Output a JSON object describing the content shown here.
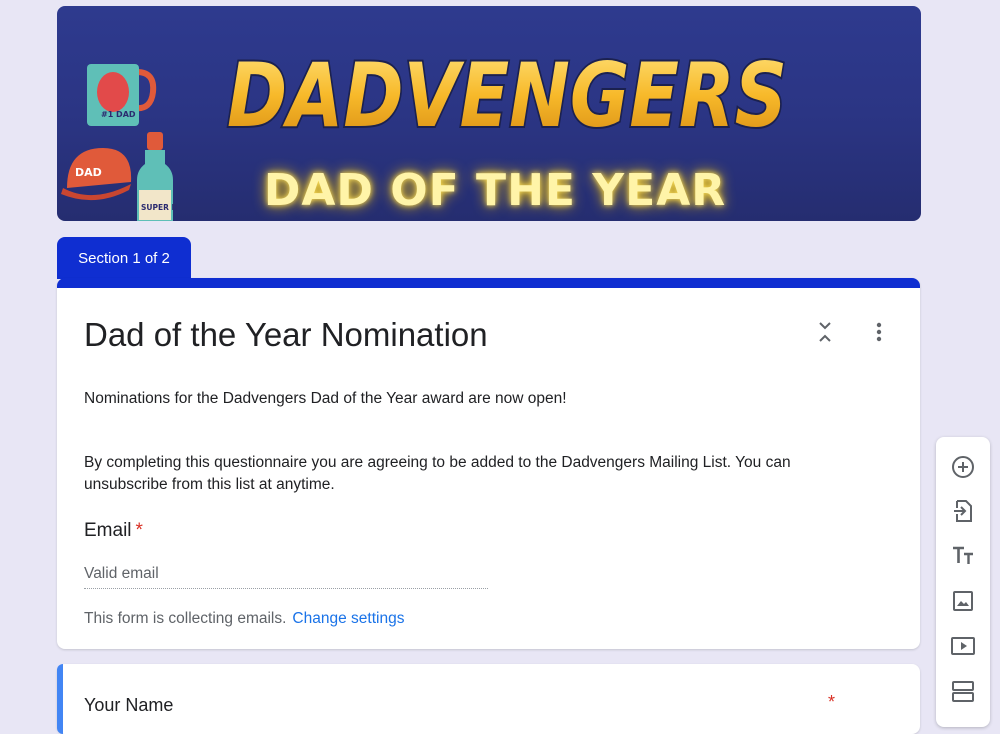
{
  "banner": {
    "logo_text": "DADVENGERS",
    "subtitle": "DAD OF THE YEAR",
    "mug_text": "#1 DAD",
    "cap_text": "DAD",
    "bottle_text": "SUPER DAD"
  },
  "section_tab": "Section 1 of 2",
  "form": {
    "title": "Dad of the Year Nomination",
    "description_1": "Nominations for the Dadvengers Dad of the Year award are now open!",
    "description_2": "By completing this questionnaire you are agreeing to be added to the Dadvengers Mailing List. You can unsubscribe from this list at anytime.",
    "email_label": "Email",
    "required_mark": "*",
    "email_placeholder": "Valid email",
    "collecting_note": "This form is collecting emails.",
    "change_settings": "Change settings"
  },
  "question_2": {
    "label": "Your Name",
    "required_mark": "*"
  },
  "toolbar": {
    "icons": [
      "add-question-icon",
      "import-questions-icon",
      "add-title-icon",
      "add-image-icon",
      "add-video-icon",
      "add-section-icon"
    ]
  },
  "colors": {
    "accent": "#0f2ed1",
    "link": "#1a73e8",
    "required": "#d93025",
    "background": "#e8e6f5"
  }
}
